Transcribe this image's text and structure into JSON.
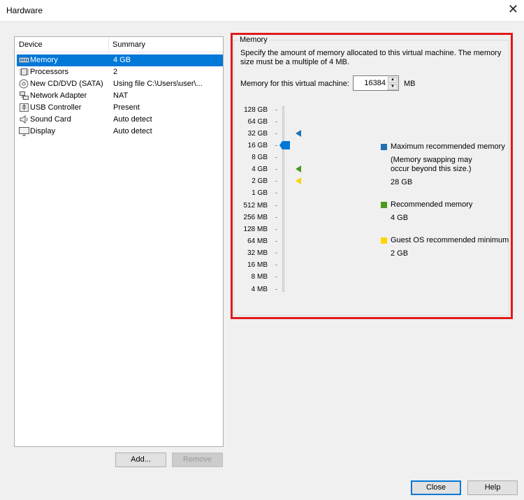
{
  "window": {
    "title": "Hardware",
    "close_glyph": "✕"
  },
  "device_list": {
    "columns": [
      "Device",
      "Summary"
    ],
    "items": [
      {
        "name": "Memory",
        "summary": "4 GB",
        "icon": "memory-icon",
        "selected": true
      },
      {
        "name": "Processors",
        "summary": "2",
        "icon": "processor-icon"
      },
      {
        "name": "New CD/DVD (SATA)",
        "summary": "Using file C:\\Users\\user\\...",
        "icon": "cd-dvd-icon"
      },
      {
        "name": "Network Adapter",
        "summary": "NAT",
        "icon": "network-adapter-icon"
      },
      {
        "name": "USB Controller",
        "summary": "Present",
        "icon": "usb-icon"
      },
      {
        "name": "Sound Card",
        "summary": "Auto detect",
        "icon": "sound-icon"
      },
      {
        "name": "Display",
        "summary": "Auto detect",
        "icon": "display-icon"
      }
    ],
    "add_label": "Add...",
    "remove_label": "Remove"
  },
  "memory": {
    "group_title": "Memory",
    "description": "Specify the amount of memory allocated to this virtual machine. The memory size must be a multiple of 4 MB.",
    "field_label": "Memory for this virtual machine:",
    "value": "16384",
    "unit": "MB",
    "scale": [
      "128 GB",
      "64 GB",
      "32 GB",
      "16 GB",
      "8 GB",
      "4 GB",
      "2 GB",
      "1 GB",
      "512 MB",
      "256 MB",
      "128 MB",
      "64 MB",
      "32 MB",
      "16 MB",
      "8 MB",
      "4 MB"
    ],
    "legend": {
      "max_label": "Maximum recommended memory",
      "max_note": "(Memory swapping may occur beyond this size.)",
      "max_value": "28 GB",
      "rec_label": "Recommended memory",
      "rec_value": "4 GB",
      "min_label": "Guest OS recommended minimum",
      "min_value": "2 GB"
    },
    "colors": {
      "max": "#1f6fb5",
      "recommended": "#4c9a1b",
      "minimum": "#ffd400",
      "thumb": "#0078d7"
    }
  },
  "footer": {
    "close_label": "Close",
    "help_label": "Help"
  }
}
